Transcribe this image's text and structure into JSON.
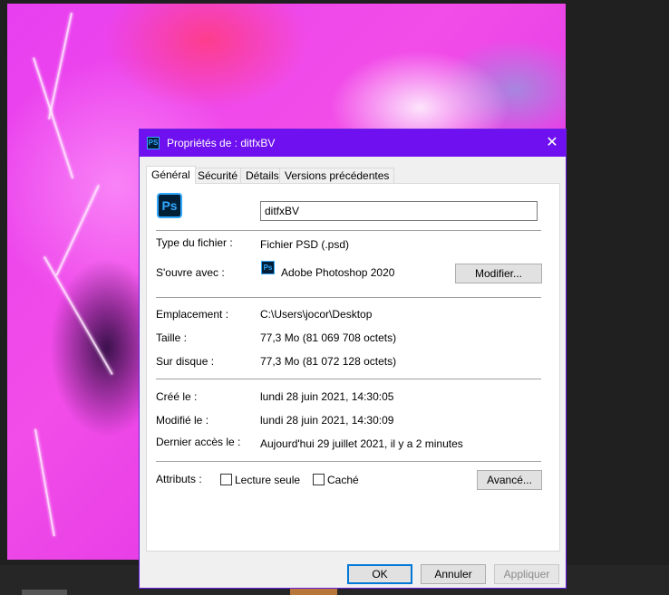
{
  "dialog": {
    "title": "Propriétés de : ditfxBV",
    "app_icon": "PS",
    "close_icon": "✕"
  },
  "tabs": [
    {
      "label": "Général"
    },
    {
      "label": "Sécurité"
    },
    {
      "label": "Détails"
    },
    {
      "label": "Versions précédentes"
    }
  ],
  "general": {
    "file_icon": "Ps",
    "filename": "ditfxBV",
    "type_label": "Type du fichier :",
    "type_value": "Fichier PSD (.psd)",
    "opens_with_label": "S'ouvre avec :",
    "opens_with_icon": "Ps",
    "opens_with_value": "Adobe Photoshop 2020",
    "modify_button": "Modifier...",
    "location_label": "Emplacement :",
    "location_value": "C:\\Users\\jocor\\Desktop",
    "size_label": "Taille :",
    "size_value": "77,3 Mo (81 069 708 octets)",
    "disk_label": "Sur disque :",
    "disk_value": "77,3 Mo (81 072 128 octets)",
    "created_label": "Créé le :",
    "created_value": "lundi 28 juin 2021, 14:30:05",
    "modified_label": "Modifié le :",
    "modified_value": "lundi 28 juin 2021, 14:30:09",
    "accessed_label": "Dernier accès le :",
    "accessed_value": "Aujourd'hui 29 juillet 2021, il y a 2 minutes",
    "attributes_label": "Attributs :",
    "readonly_label": "Lecture seule",
    "readonly_checked": false,
    "hidden_label": "Caché",
    "hidden_checked": false,
    "advanced_button": "Avancé..."
  },
  "footer": {
    "ok": "OK",
    "cancel": "Annuler",
    "apply": "Appliquer"
  },
  "colors": {
    "titlebar": "#6e10f0",
    "ps_blue": "#31a8ff",
    "ps_dark": "#001e36"
  }
}
